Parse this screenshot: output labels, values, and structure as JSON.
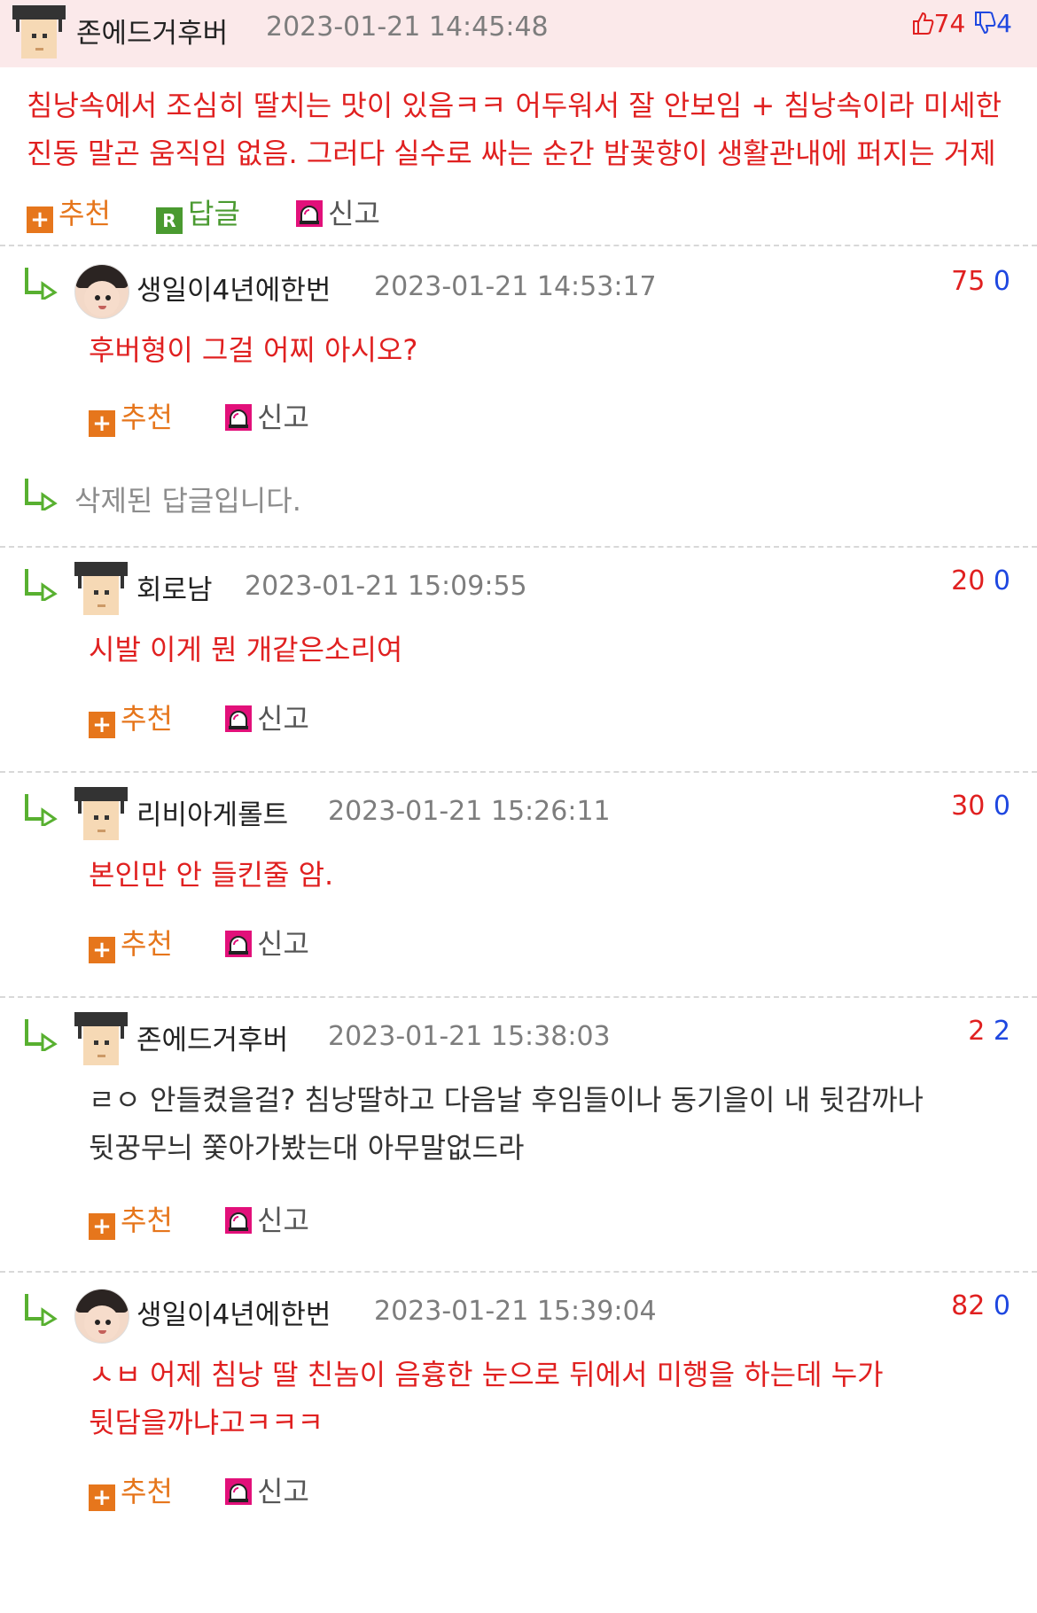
{
  "main": {
    "author": "존에드거후버",
    "date": "2023-01-21 14:45:48",
    "upvotes": "74",
    "downvotes": "4",
    "text": "침낭속에서 조심히 딸치는 맛이 있음ㅋㅋ 어두워서 잘 안보임 + 침낭속이라 미세한 진동 말곤 움직임 없음. 그러다 실수로 싸는 순간 밤꽃향이 생활관내에 퍼지는 거제",
    "actions": {
      "recommend": "추천",
      "reply": "답글",
      "report": "신고"
    }
  },
  "replies": [
    {
      "author": "생일이4년에한번",
      "date": "2023-01-21 14:53:17",
      "up": "75",
      "down": "0",
      "text": "후버형이 그걸 어찌 아시오?",
      "avatar": "baby-avatar"
    },
    {
      "deleted_text": "삭제된 답글입니다."
    },
    {
      "author": "회로남",
      "date": "2023-01-21 15:09:55",
      "up": "20",
      "down": "0",
      "text": "시발 이게 뭔 개같은소리여",
      "avatar": "student-avatar"
    },
    {
      "author": "리비아게롤트",
      "date": "2023-01-21 15:26:11",
      "up": "30",
      "down": "0",
      "text": "본인만 안 들킨줄 암.",
      "avatar": "student-avatar"
    },
    {
      "author": "존에드거후버",
      "date": "2023-01-21 15:38:03",
      "up": "2",
      "down": "2",
      "text": "ㄹㅇ 안들켰을걸? 침낭딸하고 다음날 후임들이나 동기을이 내 뒷감까나 뒷꿍무늬 쫓아가봤는대 아무말없드라",
      "avatar": "student-avatar"
    },
    {
      "author": "생일이4년에한번",
      "date": "2023-01-21 15:39:04",
      "up": "82",
      "down": "0",
      "text": "ㅅㅂ 어제 침낭 딸 친놈이 음흉한 눈으로 뒤에서 미행을 하는데 누가 뒷담을까냐고ㅋㅋㅋ",
      "avatar": "baby-avatar"
    }
  ],
  "colors": {
    "accent_red": "#e02020",
    "accent_blue": "#1e47e0",
    "recommend_orange": "#e6761c",
    "reply_green": "#4a9a30",
    "header_bg": "#fbe9ea"
  }
}
